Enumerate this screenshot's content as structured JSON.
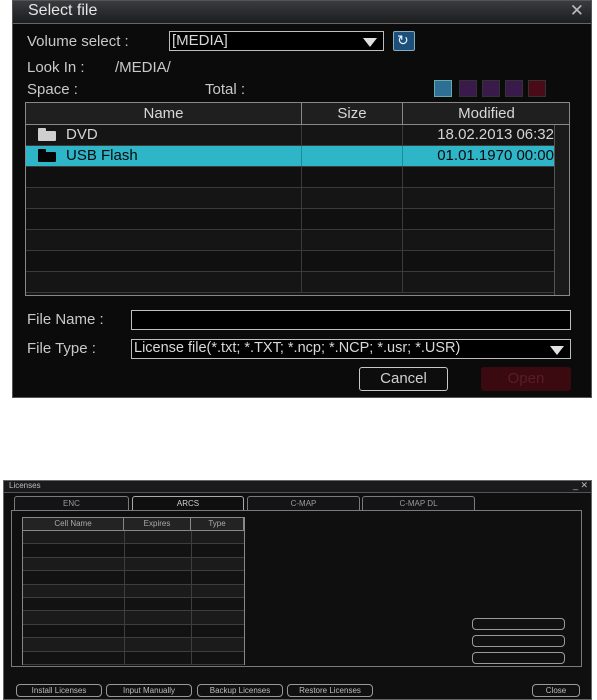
{
  "select_file": {
    "title": "Select file",
    "volume_label": "Volume select :",
    "volume_value": "[MEDIA]",
    "look_in_label": "Look In :",
    "look_in_value": "/MEDIA/",
    "space_label": "Space :",
    "total_label": "Total :",
    "columns": [
      "Name",
      "Size",
      "Modified"
    ],
    "rows": [
      {
        "name": "DVD",
        "size": "",
        "modified": "18.02.2013 06:32"
      },
      {
        "name": "USB Flash",
        "size": "",
        "modified": "01.01.1970 00:00"
      }
    ],
    "file_name_label": "File Name :",
    "file_name_value": "",
    "file_type_label": "File Type :",
    "file_type_value": "License file(*.txt; *.TXT; *.ncp; *.NCP; *.usr; *.USR)",
    "cancel_label": "Cancel",
    "open_label": "Open",
    "close_icon": "✕",
    "refresh_icon": "↻",
    "colors": {
      "selected_row": "#2fb5c8",
      "open_button": "#3a0a10",
      "open_text": "#5a1d24"
    }
  },
  "licenses": {
    "title": "Licenses",
    "window_controls": "_ ✕",
    "tabs": [
      "ENC",
      "ARCS",
      "C-MAP",
      "C-MAP DL"
    ],
    "active_tab": "ARCS",
    "columns": [
      "Cell Name",
      "Expires",
      "Type"
    ],
    "buttons": [
      "Install Licenses",
      "Input Manually",
      "Backup Licenses",
      "Restore Licenses"
    ],
    "close_label": "Close"
  }
}
